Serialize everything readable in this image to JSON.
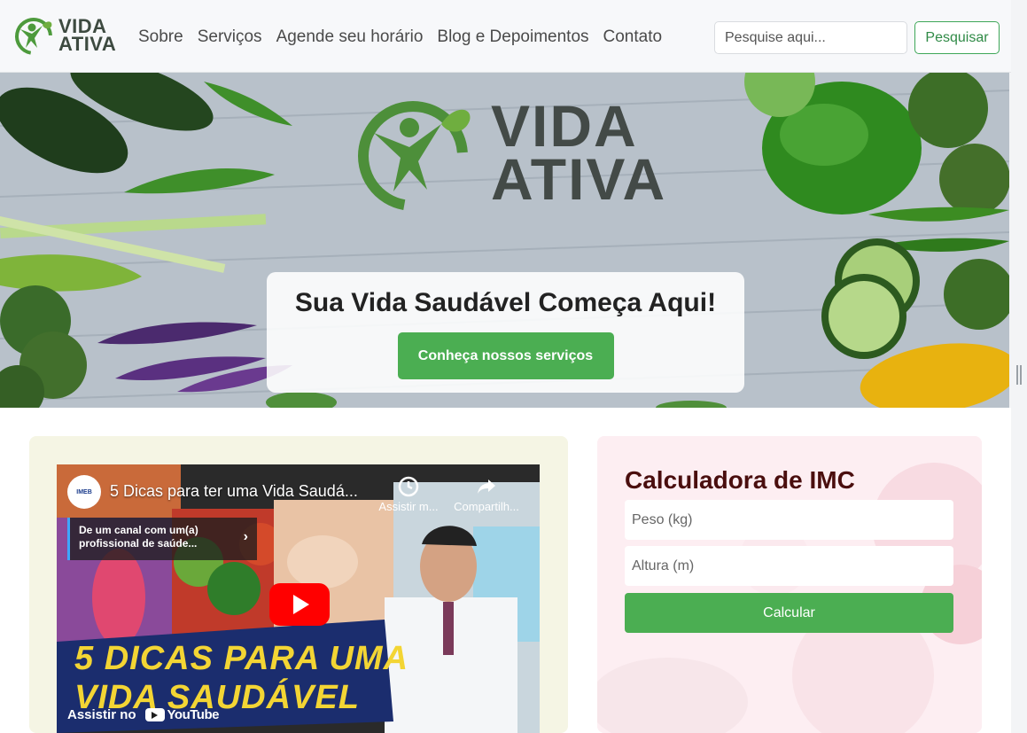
{
  "brand": {
    "line1": "VIDA",
    "line2": "ATIVA"
  },
  "nav": {
    "items": [
      {
        "label": "Sobre"
      },
      {
        "label": "Serviços"
      },
      {
        "label": "Agende seu horário"
      },
      {
        "label": "Blog e Depoimentos"
      },
      {
        "label": "Contato"
      }
    ]
  },
  "search": {
    "placeholder": "Pesquise aqui...",
    "button_label": "Pesquisar"
  },
  "hero": {
    "logo_line1": "VIDA",
    "logo_line2": "ATIVA",
    "title": "Sua Vida Saudável Começa Aqui!",
    "cta_label": "Conheça nossos serviços"
  },
  "video": {
    "channel_badge": "IMEB",
    "title": "5 Dicas para ter uma Vida Saudá...",
    "watch_later_label": "Assistir m...",
    "share_label": "Compartilh...",
    "info_card_text": "De um canal com um(a) profissional de saúde...",
    "banner_line1": "5 DICAS PARA UMA",
    "banner_line2": "VIDA SAUDÁVEL",
    "watch_on_label": "Assistir no",
    "youtube_label": "YouTube"
  },
  "imc": {
    "title": "Calculadora de IMC",
    "weight_placeholder": "Peso (kg)",
    "height_placeholder": "Altura (m)",
    "button_label": "Calcular"
  },
  "colors": {
    "accent_green": "#4bae52",
    "brand_dark": "#434a47",
    "imc_title": "#4a0e0e",
    "imc_bg": "#fdeef2",
    "video_card_bg": "#f5f5e4"
  }
}
